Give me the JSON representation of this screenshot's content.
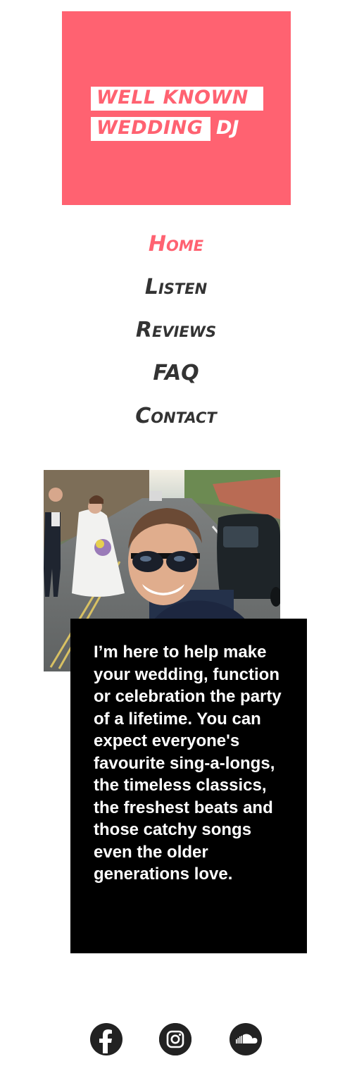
{
  "logo": {
    "line1": "WELL KNOWN",
    "line2": "WEDDING",
    "line2_suffix": "DJ",
    "background_color": "#ff6271"
  },
  "nav": {
    "items": [
      {
        "label": "Home",
        "active": true
      },
      {
        "label": "Listen",
        "active": false
      },
      {
        "label": "Reviews",
        "active": false
      },
      {
        "label": "FAQ",
        "active": false
      },
      {
        "label": "Contact",
        "active": false
      }
    ],
    "active_color": "#ff6271",
    "color": "#333333"
  },
  "intro": {
    "text": "I’m here to help make your wedding, function or celebration the party of a lifetime. You can expect everyone's favourite sing-a-longs, the timeless classics, the freshest beats and those catchy songs even the older generations love."
  },
  "social": {
    "icons": [
      "facebook-icon",
      "instagram-icon",
      "soundcloud-icon"
    ]
  }
}
